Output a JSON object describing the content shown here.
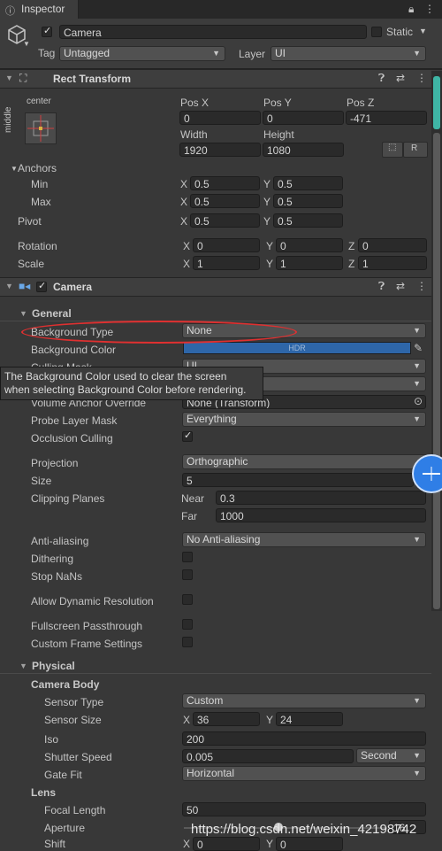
{
  "tab": {
    "title": "Inspector"
  },
  "object": {
    "name": "Camera",
    "static_label": "Static",
    "tag_label": "Tag",
    "tag_value": "Untagged",
    "layer_label": "Layer",
    "layer_value": "UI"
  },
  "rect_transform": {
    "title": "Rect Transform",
    "anchor_preset_h": "center",
    "anchor_preset_v": "middle",
    "pos_x_label": "Pos X",
    "pos_y_label": "Pos Y",
    "pos_z_label": "Pos Z",
    "pos_x": "0",
    "pos_y": "0",
    "pos_z": "-471",
    "width_label": "Width",
    "height_label": "Height",
    "width": "1920",
    "height": "1080",
    "r_button": "R",
    "anchors_label": "Anchors",
    "min_label": "Min",
    "max_label": "Max",
    "pivot_label": "Pivot",
    "x_label": "X",
    "y_label": "Y",
    "z_label": "Z",
    "min_x": "0.5",
    "min_y": "0.5",
    "max_x": "0.5",
    "max_y": "0.5",
    "pivot_x": "0.5",
    "pivot_y": "0.5",
    "rotation_label": "Rotation",
    "scale_label": "Scale",
    "rot_x": "0",
    "rot_y": "0",
    "rot_z": "0",
    "scale_x": "1",
    "scale_y": "1",
    "scale_z": "1"
  },
  "camera": {
    "title": "Camera",
    "general_label": "General",
    "bg_type_label": "Background Type",
    "bg_type_value": "None",
    "bg_color_label": "Background Color",
    "bg_color_badge": "HDR",
    "bg_color_hex": "#2e66a8",
    "culling_mask_label": "Culling Mask",
    "culling_mask_value": "UI",
    "volume_override_label": "Volume Anchor Override",
    "volume_override_value": "None (Transform)",
    "probe_mask_label": "Probe Layer Mask",
    "probe_mask_value": "Everything",
    "occlusion_label": "Occlusion Culling",
    "projection_label": "Projection",
    "projection_value": "Orthographic",
    "size_label": "Size",
    "size_value": "5",
    "clipping_label": "Clipping Planes",
    "near_label": "Near",
    "near_value": "0.3",
    "far_label": "Far",
    "far_value": "1000",
    "aa_label": "Anti-aliasing",
    "aa_value": "No Anti-aliasing",
    "dithering_label": "Dithering",
    "stopnans_label": "Stop NaNs",
    "dynres_label": "Allow Dynamic Resolution",
    "passthrough_label": "Fullscreen Passthrough",
    "custom_frame_label": "Custom Frame Settings",
    "physical_label": "Physical",
    "camera_body_label": "Camera Body",
    "sensor_type_label": "Sensor Type",
    "sensor_type_value": "Custom",
    "sensor_size_label": "Sensor Size",
    "sensor_x": "36",
    "sensor_y": "24",
    "iso_label": "Iso",
    "iso_value": "200",
    "shutter_label": "Shutter Speed",
    "shutter_value": "0.005",
    "shutter_unit": "Second",
    "gate_label": "Gate Fit",
    "gate_value": "Horizontal",
    "lens_label": "Lens",
    "focal_label": "Focal Length",
    "focal_value": "50",
    "aperture_label": "Aperture",
    "aperture_value": "16",
    "shift_label": "Shift",
    "shift_x": "0",
    "shift_y": "0"
  },
  "tooltip": {
    "line1": "The Background Color used to clear the screen",
    "line2": "when selecting Background Color before rendering."
  },
  "watermark": "https://blog.csdn.net/weixin_42198742",
  "colors": {
    "accent": "#3fb5a5",
    "annotation": "#e03030",
    "bubble": "#2f7ee6"
  }
}
